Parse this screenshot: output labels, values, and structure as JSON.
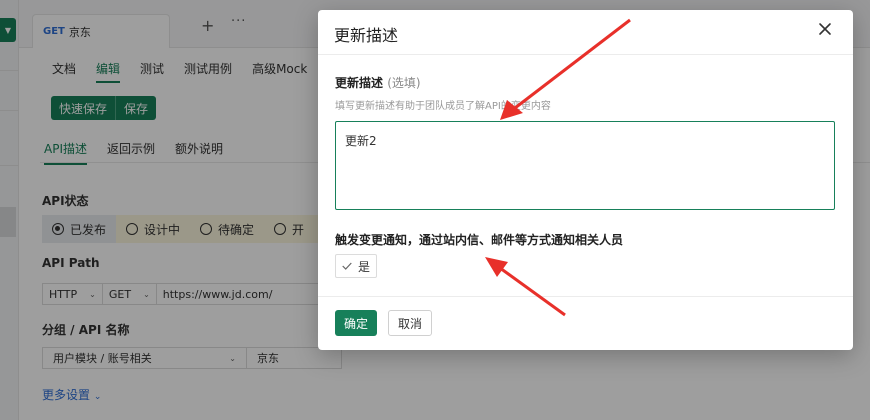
{
  "colors": {
    "accent": "#17805a",
    "link": "#2f6fd6",
    "arrow": "#e8302a",
    "status_bg": "#fbf6de"
  },
  "tab": {
    "method": "GET",
    "name": "京东"
  },
  "subtabs": [
    "文档",
    "编辑",
    "测试",
    "测试用例",
    "高级Mock"
  ],
  "actions": {
    "quick_save": "快速保存",
    "save": "保存"
  },
  "doc_tabs": [
    "API描述",
    "返回示例",
    "额外说明"
  ],
  "api_status": {
    "label": "API状态",
    "options": [
      "已发布",
      "设计中",
      "待确定",
      "开"
    ]
  },
  "api_path": {
    "label": "API Path",
    "protocol": "HTTP",
    "method": "GET",
    "url": "https://www.jd.com/"
  },
  "group": {
    "label": "分组 / API 名称",
    "path": "用户模块 / 账号相关",
    "name": "京东"
  },
  "more_settings": "更多设置",
  "modal": {
    "title": "更新描述",
    "desc_label": "更新描述",
    "desc_optional": "(选填)",
    "hint": "填写更新描述有助于团队成员了解API的变更内容",
    "desc_value": "更新2",
    "notify_label": "触发变更通知，通过站内信、邮件等方式通知相关人员",
    "checkbox_label": "是",
    "ok": "确定",
    "cancel": "取消"
  }
}
